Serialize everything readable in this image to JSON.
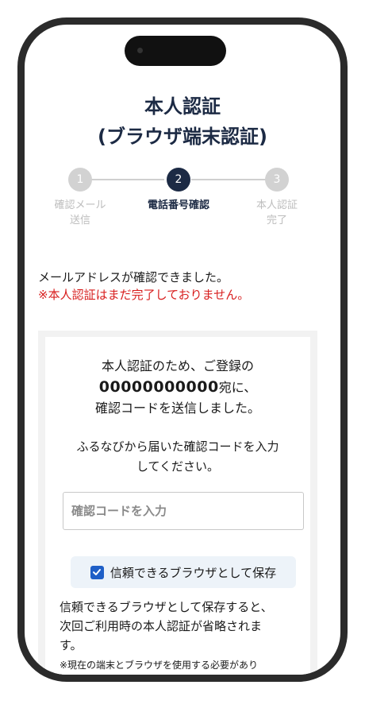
{
  "page": {
    "title_line1": "本人認証",
    "title_line2": "(ブラウザ端末認証)"
  },
  "steps": [
    {
      "number": "1",
      "label_line1": "確認メール",
      "label_line2": "送信",
      "state": "done"
    },
    {
      "number": "2",
      "label_line1": "電話番号確認",
      "label_line2": "",
      "state": "active"
    },
    {
      "number": "3",
      "label_line1": "本人認証",
      "label_line2": "完了",
      "state": "pending"
    }
  ],
  "message": {
    "confirmed": "メールアドレスが確認できました。",
    "warning": "※本人認証はまだ完了しておりません。"
  },
  "card": {
    "line1": "本人認証のため、ご登録の",
    "phone_number": "00000000000",
    "line2_suffix": "宛に、",
    "line3": "確認コードを送信しました。",
    "sub_line1": "ふるなびから届いた確認コードを入力",
    "sub_line2": "してください。",
    "code_placeholder": "確認コードを入力",
    "trust_checkbox_label": "信頼できるブラウザとして保存",
    "trust_checked": true,
    "note_line1": "信頼できるブラウザとして保存すると、",
    "note_line2": "次回ご利用時の本人認証が省略されま",
    "note_line3": "す。",
    "note_small": "※現在の端末とブラウザを使用する必要があり"
  },
  "colors": {
    "primary": "#1c2a44",
    "inactive": "#d2d2d2",
    "warning": "#d81e1e",
    "checkbox": "#1f5fc7",
    "trust_bg": "#edf3f9"
  }
}
